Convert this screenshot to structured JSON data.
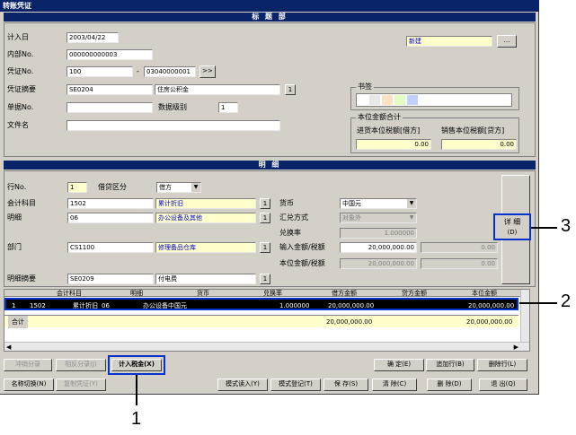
{
  "window": {
    "title": "转账凭证"
  },
  "header_section": {
    "title": "标 题 部",
    "date_label": "计入日",
    "date_value": "2003/04/22",
    "internal_no_label": "内部No.",
    "internal_no_value": "000000000003",
    "voucher_no_label": "凭证No.",
    "voucher_no_a": "100",
    "voucher_no_sep": "-",
    "voucher_no_b": "03040000001",
    "voucher_no_btn": ">>",
    "summary_label": "凭证摘要",
    "summary_code": "SE0204",
    "summary_text": "住房公积金",
    "summary_btn": "1",
    "doc_no_label": "单据No.",
    "doc_no_value": "",
    "data_level_label": "数据级别",
    "data_level_value": "1",
    "file_label": "文件名",
    "file_value": "",
    "status_value": "新建",
    "status_btn": "...",
    "bookmark_label": "书签",
    "total_label": "本位金额合计",
    "input_tax_label": "进货本位税额[借方]",
    "input_tax_value": "0.00",
    "output_tax_label": "销售本位税额[贷方]",
    "output_tax_value": "0.00"
  },
  "detail_section": {
    "title": "明 细",
    "line_no_label": "行No.",
    "line_no_value": "1",
    "dc_label": "借贷区分",
    "dc_value": "借方",
    "account_label": "会计科目",
    "account_code": "1502",
    "account_name": "累计折旧",
    "account_btn": "1",
    "detail_label": "明细",
    "detail_code": "06",
    "detail_name": "办公设备及其他",
    "detail_btn": "1",
    "dept_label": "部门",
    "dept_code": "CS1100",
    "dept_name": "修理备品仓库",
    "dept_btn": "1",
    "memo_label": "明细摘要",
    "memo_code": "SE0209",
    "memo_name": "付电费",
    "memo_btn": "1",
    "currency_label": "货币",
    "currency_value": "中国元",
    "exchange_method_label": "汇兑方式",
    "exchange_method_value": "对象外",
    "rate_label": "兑换率",
    "rate_value": "1.000000",
    "input_amount_label": "输入金额/税额",
    "input_amount_value": "20,000,000.00",
    "input_tax_value": "0.00",
    "base_amount_label": "本位金额/税额",
    "base_amount_value": "20,000,000.00",
    "base_tax_value": "0.00",
    "details_btn_line1": "详 细",
    "details_btn_line2": "(D)"
  },
  "grid": {
    "columns": [
      "",
      "会计科目",
      "明细",
      "货币",
      "兑换率",
      "借方金额",
      "贷方金额",
      "本位金额"
    ],
    "rows": [
      {
        "no": "1",
        "account": "1502",
        "account_name": "累计折旧",
        "detail": "06",
        "detail_name": "办公设备",
        "currency": "中国元",
        "rate": "1.000000",
        "debit": "20,000,000.00",
        "credit": "",
        "base": "20,000,000.00"
      }
    ],
    "total_label": "合计",
    "total_debit": "20,000,000.00",
    "total_credit": "",
    "total_base": "20,000,000.00"
  },
  "buttons_row1": {
    "offset_entry": "冲销分录",
    "same_entry": "相反分录(J)",
    "tax_entry": "计入税金(X)",
    "confirm": "确  定(E)",
    "add_row": "追加行(B)",
    "delete_row": "删除行(L)"
  },
  "buttons_row2": {
    "name_toggle": "名称切换(N)",
    "copy_voucher": "复制凭证(Y)",
    "mode_load": "模式读入(Y)",
    "mode_register": "模式登记(T)",
    "save": "保  存(S)",
    "clear": "清  除(C)",
    "delete": "删  除(D)",
    "exit": "退  出(Q)"
  },
  "callouts": {
    "c1": "1",
    "c2": "2",
    "c3": "3"
  }
}
